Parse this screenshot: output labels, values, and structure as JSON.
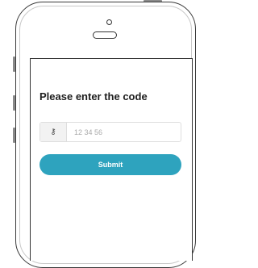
{
  "screen": {
    "heading": "Please enter the code",
    "code_field": {
      "icon": "key-icon",
      "icon_glyph": "⚷",
      "placeholder": "12 34 56",
      "value": ""
    },
    "submit_label": "Submit"
  },
  "colors": {
    "accent": "#2ea3be",
    "phone_outline": "#3a3a3a",
    "heading_text": "#1e1e1e",
    "placeholder_text": "#aaaaaa"
  }
}
